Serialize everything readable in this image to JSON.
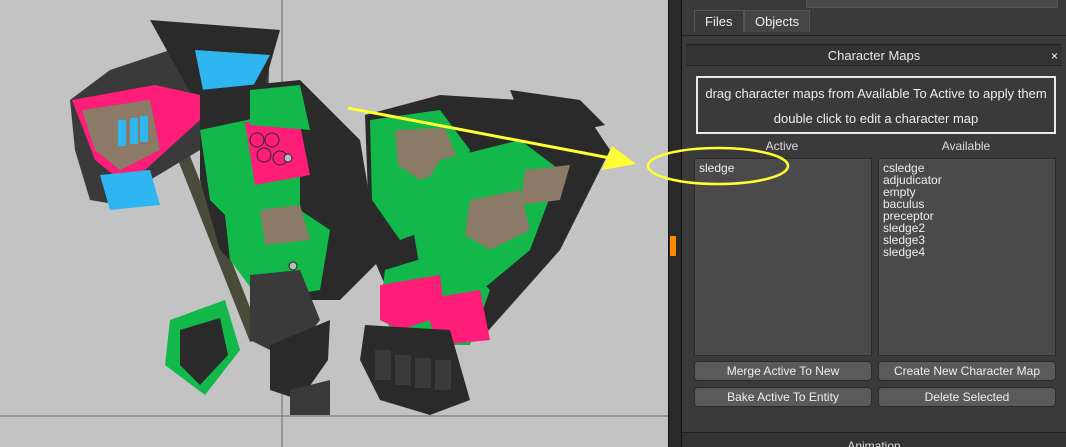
{
  "tabs": {
    "files": "Files",
    "objects": "Objects"
  },
  "character_maps": {
    "header": "Character Maps",
    "close_glyph": "×",
    "hint_line1": "drag character maps from Available To Active to apply them",
    "hint_line2": "double click to edit a character map",
    "active_label": "Active",
    "available_label": "Available",
    "active_items": [
      "sledge"
    ],
    "available_items": [
      "csledge",
      "adjudicator",
      "empty",
      "baculus",
      "preceptor",
      "sledge2",
      "sledge3",
      "sledge4"
    ],
    "buttons": {
      "merge": "Merge Active To New",
      "create": "Create New Character Map",
      "bake": "Bake Active To Entity",
      "delete": "Delete Selected"
    }
  },
  "bottom_panel_title": "Animation",
  "colors": {
    "annotation_yellow": "#ffff33",
    "splitter_handle": "#ff8a00",
    "character_green": "#12b84a",
    "character_pink": "#ff1d7a",
    "character_blue": "#2fb6f0"
  }
}
